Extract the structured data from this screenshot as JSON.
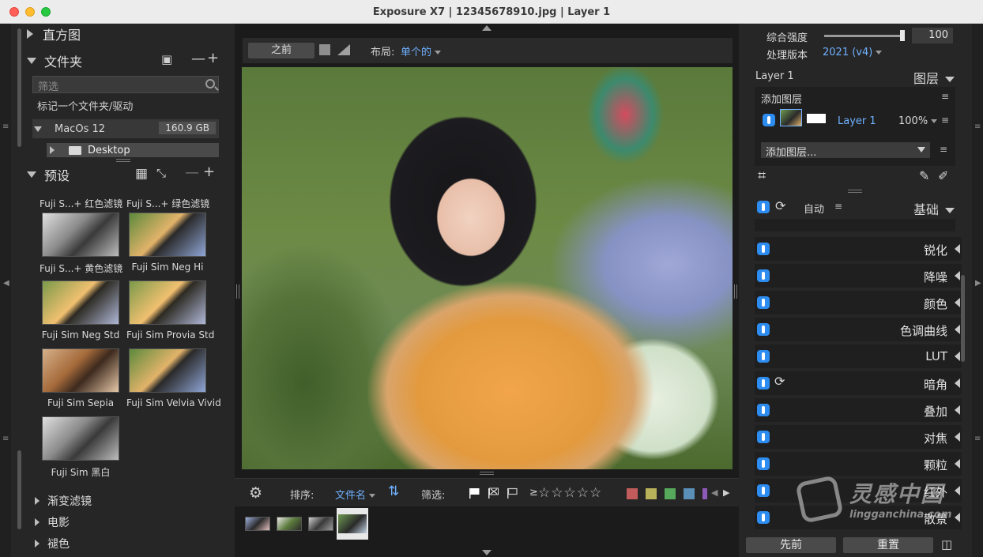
{
  "window": {
    "title": "Exposure X7 | 12345678910.jpg | Layer 1"
  },
  "left": {
    "histogram_label": "直方图",
    "folders_label": "文件夹",
    "search_placeholder": "筛选",
    "hint": "标记一个文件夹/驱动",
    "drive": {
      "name": "MacOs 12",
      "size": "160.9 GB"
    },
    "desktop": "Desktop",
    "presets_label": "预设",
    "presets": [
      {
        "label": "Fuji S...+ 红色滤镜"
      },
      {
        "label": "Fuji S...+ 绿色滤镜"
      },
      {
        "label": "Fuji S...+ 黄色滤镜"
      },
      {
        "label": "Fuji Sim Neg Hi"
      },
      {
        "label": "Fuji Sim Neg Std"
      },
      {
        "label": "Fuji Sim Provia Std"
      },
      {
        "label": "Fuji Sim Sepia"
      },
      {
        "label": "Fuji Sim Velvia Vivid"
      },
      {
        "label": "Fuji Sim 黑白"
      }
    ],
    "categories": [
      "渐变滤镜",
      "电影",
      "褪色"
    ]
  },
  "mid": {
    "before_button": "之前",
    "layout_label": "布局:",
    "layout_value": "单个的",
    "sort_label": "排序:",
    "sort_value": "文件名",
    "filter_label": "筛选:",
    "rating_prefix": "≥",
    "stars": "☆☆☆☆☆",
    "color_swatches": [
      "#c25b5b",
      "#b8b35a",
      "#56a95a",
      "#5a8fb8",
      "#8e5ab8"
    ]
  },
  "right": {
    "strength_label": "综合强度",
    "strength_value": "100",
    "version_label": "处理版本",
    "version_value": "2021 (v4)",
    "layer_name_top": "Layer 1",
    "layers_label": "图层",
    "add_layer": "添加图层",
    "layer_row": {
      "name": "Layer 1",
      "opacity": "100%"
    },
    "add_layer_select": "添加图层...",
    "auto_label": "自动",
    "basic_label": "基础",
    "adjustments": [
      "锐化",
      "降噪",
      "颜色",
      "色调曲线",
      "LUT",
      "暗角",
      "叠加",
      "对焦",
      "颗粒",
      "红外",
      "散景"
    ],
    "prev_button": "先前",
    "reset_button": "重置"
  },
  "watermark": {
    "main": "灵感中国",
    "sub": "lingganchina.com"
  }
}
